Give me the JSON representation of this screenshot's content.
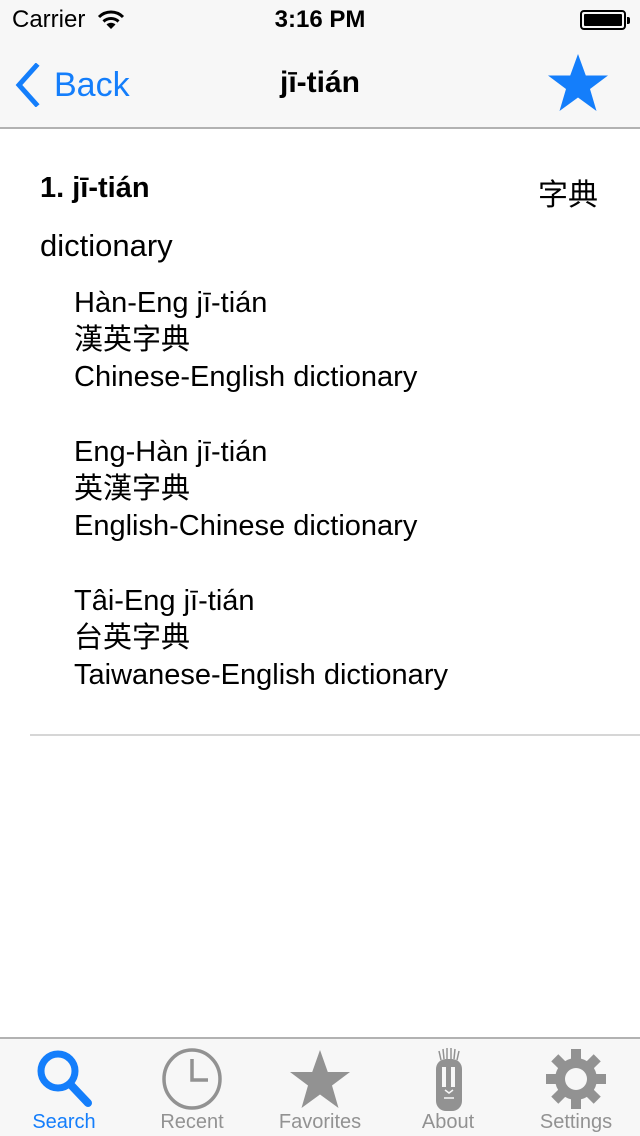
{
  "status_bar": {
    "carrier": "Carrier",
    "time": "3:16 PM",
    "battery_level": 1.0
  },
  "nav": {
    "back_label": "Back",
    "title": "jī-tián",
    "favorite_icon": "star-icon"
  },
  "entry": {
    "heading": "1. jī-tián",
    "hanzi": "字典",
    "definition": "dictionary",
    "examples": [
      {
        "romanization": "Hàn-Eng jī-tián",
        "hanzi": "漢英字典",
        "translation": "Chinese-English dictionary"
      },
      {
        "romanization": "Eng-Hàn jī-tián",
        "hanzi": "英漢字典",
        "translation": "English-Chinese dictionary"
      },
      {
        "romanization": "Tâi-Eng jī-tián",
        "hanzi": "台英字典",
        "translation": "Taiwanese-English dictionary"
      }
    ]
  },
  "tabs": [
    {
      "label": "Search",
      "icon": "search-icon",
      "active": true
    },
    {
      "label": "Recent",
      "icon": "clock-icon",
      "active": false
    },
    {
      "label": "Favorites",
      "icon": "star-icon",
      "active": false
    },
    {
      "label": "About",
      "icon": "tiki-mask-icon",
      "active": false
    },
    {
      "label": "Settings",
      "icon": "gear-icon",
      "active": false
    }
  ],
  "colors": {
    "accent": "#147efb",
    "inactive": "#929292",
    "bar_background": "#f7f7f7"
  }
}
